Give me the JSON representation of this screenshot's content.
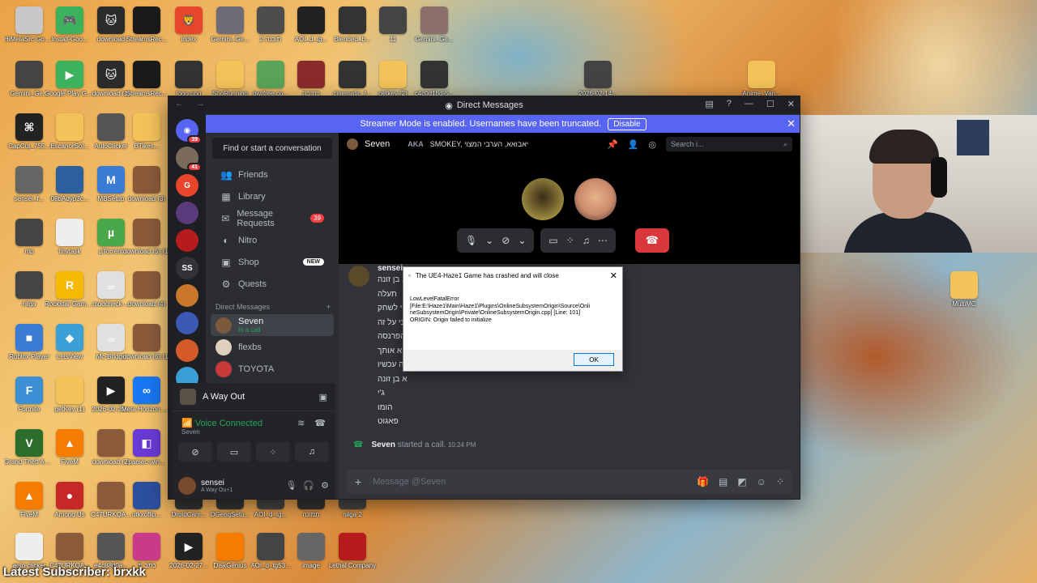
{
  "desktop": {
    "icons": [
      {
        "label": "HiMelaSrc Gobblemo...",
        "color": "#c8c8c8",
        "glyph": ""
      },
      {
        "label": "Install-Goo...",
        "color": "#3bb25b",
        "glyph": "🎮"
      },
      {
        "label": "download",
        "color": "#2b2b2b",
        "glyph": "🐱"
      },
      {
        "label": "StreamsRec...",
        "color": "#1a1a1a",
        "glyph": ""
      },
      {
        "label": "index",
        "color": "#e8462b",
        "glyph": "🦁"
      },
      {
        "label": "Gemini_Ge...",
        "color": "#6e6a78",
        "glyph": ""
      },
      {
        "label": "2 תוכנה",
        "color": "#4d4d4d",
        "glyph": ""
      },
      {
        "label": "AOI_d_tg...",
        "color": "#222",
        "glyph": ""
      },
      {
        "label": "Blended_b...",
        "color": "#333",
        "glyph": ""
      },
      {
        "label": "11",
        "color": "#444",
        "glyph": ""
      },
      {
        "label": "Gemini_Ge...",
        "color": "#8a6f6a",
        "glyph": ""
      },
      {
        "label": "Gemini_Ge...",
        "color": "#444",
        "glyph": ""
      },
      {
        "label": "Google Play Games XOZ",
        "color": "#3bb25b",
        "glyph": "▶"
      },
      {
        "label": "download (1)",
        "color": "#2b2b2b",
        "glyph": "🐱"
      },
      {
        "label": "StreamsRec...",
        "color": "#1a1a1a",
        "glyph": ""
      },
      {
        "label": "logo.png",
        "color": "#333",
        "glyph": ""
      },
      {
        "label": "ShoRunning",
        "color": "#f3c35a",
        "glyph": ""
      },
      {
        "label": "pwrfree.co...",
        "color": "#5aa35a",
        "glyph": ""
      },
      {
        "label": "כתובה",
        "color": "#8a2b2b",
        "glyph": ""
      },
      {
        "label": "cinematic_f...",
        "color": "#333",
        "glyph": ""
      },
      {
        "label": "getkey (2)",
        "color": "#f3c35a",
        "glyph": ""
      },
      {
        "label": "c4c0d1bd-5...",
        "color": "#333",
        "glyph": ""
      },
      {
        "label": "2026-02-14...",
        "color": "#444",
        "glyph": ""
      },
      {
        "label": "Anime_Van...",
        "color": "#f3c35a",
        "glyph": ""
      },
      {
        "label": "CapCut_755...",
        "color": "#222",
        "glyph": "⌘"
      },
      {
        "label": "EscanorSol...",
        "color": "#f3c35a",
        "glyph": ""
      },
      {
        "label": "AutoClicker",
        "color": "#555",
        "glyph": ""
      },
      {
        "label": "BTikes...",
        "color": "#f3c35a",
        "glyph": ""
      },
      {
        "label": "sensei_f...",
        "color": "#666",
        "glyph": ""
      },
      {
        "label": "08bAdyp3c...",
        "color": "#2c5f9e",
        "glyph": ""
      },
      {
        "label": "MBSetup",
        "color": "#3a7bd5",
        "glyph": "M"
      },
      {
        "label": "download (3)",
        "color": "#8a5a3a",
        "glyph": ""
      },
      {
        "label": "mp",
        "color": "#444",
        "glyph": ""
      },
      {
        "label": "tinytask",
        "color": "#eee",
        "glyph": ""
      },
      {
        "label": "µTorrent",
        "color": "#4aa84a",
        "glyph": "µ"
      },
      {
        "label": "download (5) (1)",
        "color": "#8a5a3a",
        "glyph": ""
      },
      {
        "label": "nilga",
        "color": "#444",
        "glyph": ""
      },
      {
        "label": "Rockstar Games Lau...",
        "color": "#f6b900",
        "glyph": "R"
      },
      {
        "label": "modcheck-...",
        "color": "#e0e0e0",
        "glyph": "☕"
      },
      {
        "label": "download (4)",
        "color": "#8a5a3a",
        "glyph": ""
      },
      {
        "label": "Roblox Player",
        "color": "#3a7bd5",
        "glyph": "■"
      },
      {
        "label": "LetsView",
        "color": "#3aa0d5",
        "glyph": "◆"
      },
      {
        "label": "Mc-Bridge",
        "color": "#e0e0e0",
        "glyph": "☕"
      },
      {
        "label": "download (6) (1)",
        "color": "#8a5a3a",
        "glyph": ""
      },
      {
        "label": "Fortnite",
        "color": "#3a8fd5",
        "glyph": "F"
      },
      {
        "label": "getKey (1)",
        "color": "#f3c35a",
        "glyph": ""
      },
      {
        "label": "2026-02-20...",
        "color": "#222",
        "glyph": "▶"
      },
      {
        "label": "Meta Horizon Link",
        "color": "#1877f2",
        "glyph": "∞"
      },
      {
        "label": "Grand Theft Auto V",
        "color": "#2b6e2b",
        "glyph": "V"
      },
      {
        "label": "FiveM",
        "color": "#f57c00",
        "glyph": "▲"
      },
      {
        "label": "download (2)",
        "color": "#8a5a3a",
        "glyph": ""
      },
      {
        "label": "parsec-win...",
        "color": "#6a3ad5",
        "glyph": "◧"
      },
      {
        "label": "FiveM",
        "color": "#f57c00",
        "glyph": "▲"
      },
      {
        "label": "Among Us",
        "color": "#c62828",
        "glyph": "●"
      },
      {
        "label": "C47URKQA...",
        "color": "#8a5a3a",
        "glyph": ""
      },
      {
        "label": "utkxofljp...",
        "color": "#2c4f9e",
        "glyph": ""
      },
      {
        "label": "DroidCam...",
        "color": "#333",
        "glyph": ""
      },
      {
        "label": "DGengSetu...",
        "color": "#333",
        "glyph": ""
      },
      {
        "label": "AOI_d_tg...",
        "color": "#444",
        "glyph": ""
      },
      {
        "label": "תמונה",
        "color": "#333",
        "glyph": ""
      },
      {
        "label": "nilga 2",
        "color": "#444",
        "glyph": ""
      },
      {
        "label": "auto-clicker",
        "color": "#eee",
        "glyph": ""
      },
      {
        "label": "C47URKQA...",
        "color": "#8a5a3a",
        "glyph": ""
      },
      {
        "label": "e4c88d0a...",
        "color": "#555",
        "glyph": ""
      },
      {
        "label": "כתב יד",
        "color": "#c83a8a",
        "glyph": ""
      },
      {
        "label": "2026-02-27...",
        "color": "#222",
        "glyph": "▶"
      },
      {
        "label": "DiskGenius",
        "color": "#f57c00",
        "glyph": ""
      },
      {
        "label": "AOI_d_tg53...",
        "color": "#444",
        "glyph": ""
      },
      {
        "label": "image",
        "color": "#666",
        "glyph": ""
      },
      {
        "label": "Lethal Company",
        "color": "#b71c1c",
        "glyph": ""
      },
      {
        "label": "MultiMC",
        "color": "#f3c35a",
        "glyph": ""
      }
    ],
    "subscriber_text": "Latest Subscriber: brxkk"
  },
  "window": {
    "title": "Direct Messages",
    "streamer_banner": "Streamer Mode is enabled. Usernames have been truncated.",
    "disable_label": "Disable"
  },
  "rail": {
    "servers": [
      {
        "glyph": "◉",
        "color": "#5865f2",
        "badge": "39"
      },
      {
        "glyph": "",
        "color": "#7a6b5a",
        "badge": "41"
      },
      {
        "glyph": "G",
        "color": "#e8462b",
        "badge": ""
      },
      {
        "glyph": "",
        "color": "#5a3a7a",
        "badge": ""
      },
      {
        "glyph": "",
        "color": "#b71c1c",
        "badge": ""
      },
      {
        "glyph": "SS",
        "color": "#313338",
        "badge": ""
      },
      {
        "glyph": "",
        "color": "#c9772a",
        "badge": ""
      },
      {
        "glyph": "",
        "color": "#3a5ab5",
        "badge": ""
      },
      {
        "glyph": "",
        "color": "#d55a2a",
        "badge": ""
      },
      {
        "glyph": "",
        "color": "#3aa0d5",
        "badge": ""
      }
    ]
  },
  "sidebar": {
    "find_label": "Find or start a conversation",
    "nav": [
      {
        "icon": "friends-icon",
        "glyph": "👥",
        "label": "Friends",
        "count": "",
        "tag": ""
      },
      {
        "icon": "library-icon",
        "glyph": "▦",
        "label": "Library",
        "count": "",
        "tag": ""
      },
      {
        "icon": "message-requests-icon",
        "glyph": "✉",
        "label": "Message Requests",
        "count": "39",
        "tag": ""
      },
      {
        "icon": "nitro-icon",
        "glyph": "◐",
        "label": "Nitro",
        "count": "",
        "tag": ""
      },
      {
        "icon": "shop-icon",
        "glyph": "▣",
        "label": "Shop",
        "count": "",
        "tag": "NEW"
      },
      {
        "icon": "quests-icon",
        "glyph": "⚙",
        "label": "Quests",
        "count": "",
        "tag": ""
      }
    ],
    "dm_header": "Direct Messages",
    "dms": [
      {
        "name": "Seven",
        "sub": "In a call",
        "color": "#7a5a3a"
      },
      {
        "name": "flexbs",
        "sub": "",
        "color": "#e0d0c0"
      },
      {
        "name": "TOYOTA",
        "sub": "",
        "color": "#c83a3a"
      }
    ]
  },
  "activity": {
    "game": "A Way Out",
    "voice_title": "Voice Connected",
    "voice_sub": "Seven",
    "user_name": "sensei",
    "user_status": "A Way Ou+1"
  },
  "call": {
    "name": "Seven",
    "aka_label": "AKA",
    "aka_names": "SMOKEY, יאבואא, הערבי המצוי",
    "search_placeholder": "Search i..."
  },
  "chat": {
    "sender": "sensei",
    "lines": [
      "א בן זונה",
      "תעלה",
      "י לשחק",
      "ני על זה",
      "הפרנסה",
      "א אותך",
      "ה עכשיו",
      "א בן זונה",
      "ג'י",
      "הומו",
      "פאגוט"
    ],
    "sys_name": "Seven",
    "sys_text": "started a call.",
    "sys_time": "10:24 PM",
    "composer_placeholder": "Message @Seven"
  },
  "dialog": {
    "title": "The UE4-Haze1 Game has crashed and will close",
    "line1": "LowLevelFatalError",
    "line2": "[File:E:\\Haze1\\Main\\Haze1\\Plugins\\OnlineSubsystemOrigin\\Source\\Onli",
    "line3": "neSubsystemOrigin\\Private\\OnlineSubsystemOrigin.cpp] [Line: 101]",
    "line4": "ORIGIN: Origin failed to initialize",
    "ok_label": "OK"
  }
}
